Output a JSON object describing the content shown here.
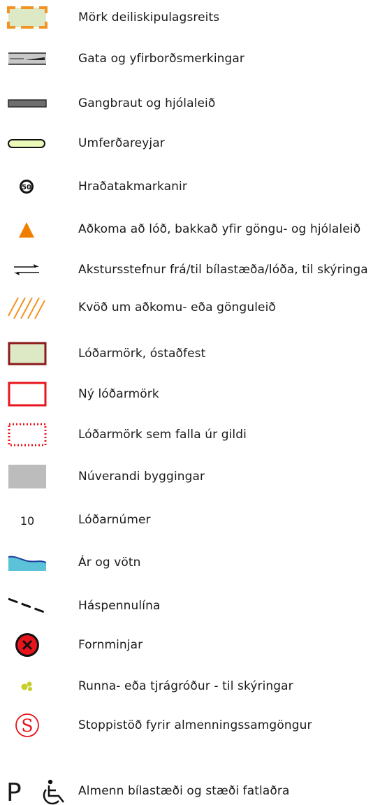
{
  "legend": {
    "items": [
      {
        "id": "mork-deiliskipulagsreits",
        "icon": "dashed-orange-boundary-icon",
        "label": "Mörk deiliskipulagsreits"
      },
      {
        "id": "gata",
        "icon": "road-marking-icon",
        "label": "Gata og yfirborðsmerkingar"
      },
      {
        "id": "gangbraut",
        "icon": "path-bar-icon",
        "label": "Gangbraut og hjólaleið"
      },
      {
        "id": "umferdareyjar",
        "icon": "traffic-island-icon",
        "label": "Umferðareyjar"
      },
      {
        "id": "hradatakmarkanir",
        "icon": "speed-limit-icon",
        "label": "Hraðatakmarkanir",
        "symbol_text": "50"
      },
      {
        "id": "adkoma",
        "icon": "orange-triangle-icon",
        "label": "Aðkoma að lóð, bakkað yfir göngu- og hjólaleið"
      },
      {
        "id": "akstursstefnur",
        "icon": "two-way-arrows-icon",
        "label": "Akstursstefnur frá/til bílastæða/lóða, til skýringa"
      },
      {
        "id": "kvod",
        "icon": "orange-hatch-icon",
        "label": "Kvöð um aðkomu- eða gönguleið"
      },
      {
        "id": "lodarmork-ostadfest",
        "icon": "green-lot-boundary-icon",
        "label": "Lóðarmörk, óstaðfest"
      },
      {
        "id": "ny-lodarmork",
        "icon": "red-lot-boundary-icon",
        "label": "Ný lóðarmörk"
      },
      {
        "id": "lodarmork-falla",
        "icon": "dotted-red-boundary-icon",
        "label": "Lóðarmörk sem falla úr gildi"
      },
      {
        "id": "nuverandi-byggingar",
        "icon": "gray-building-icon",
        "label": "Núverandi byggingar"
      },
      {
        "id": "lodarnumer",
        "icon": "lot-number-icon",
        "label": "Lóðarnúmer",
        "symbol_text": "10"
      },
      {
        "id": "ar-og-votn",
        "icon": "water-icon",
        "label": "Ár og vötn"
      },
      {
        "id": "haspennulina",
        "icon": "dashed-line-icon",
        "label": "Háspennulína"
      },
      {
        "id": "fornminjar",
        "icon": "red-cross-circle-icon",
        "label": "Fornminjar"
      },
      {
        "id": "runna",
        "icon": "shrub-icon",
        "label": "Runna- eða tjrágróður - til skýringar"
      },
      {
        "id": "stoppistod",
        "icon": "bus-stop-s-icon",
        "label": "Stoppistöð fyrir almenningssamgöngur",
        "symbol_text": "S"
      },
      {
        "id": "bilastaedi",
        "icon": "parking-accessible-icon",
        "label": "Almenn bílastæði og stæði fatlaðra",
        "symbol_text": "P"
      }
    ]
  },
  "colors": {
    "orange": "#f39324",
    "dark_red": "#8b1a1a",
    "red": "#e8141b",
    "pale_green": "#dde8c4",
    "gray": "#bcbcbc",
    "water": "#5bc2d8",
    "island": "#eaf8b8",
    "shrub": "#c6cf2a"
  }
}
